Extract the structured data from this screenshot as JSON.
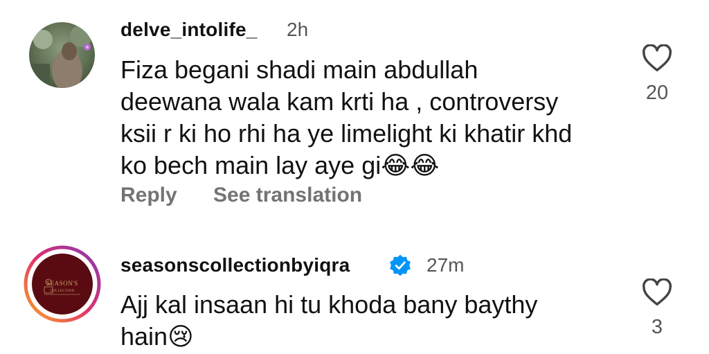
{
  "comments": [
    {
      "username": "delve_intolife_",
      "time": "2h",
      "lines": [
        "Fiza begani shadi main abdullah",
        "deewana wala kam krti ha , controversy",
        "ksii r ki ho rhi ha ye limelight ki khatir khd",
        "ko bech main lay aye gi"
      ],
      "emoji": [
        "😂",
        "😂"
      ],
      "emoji_icon": "face-with-tears-of-joy-icon",
      "like_count": "20",
      "reply_label": "Reply",
      "translate_label": "See translation"
    },
    {
      "username": "seasonscollectionbyiqra",
      "verified": true,
      "time": "27m",
      "lines": [
        "Ajj kal insaan hi tu khoda bany baythy",
        "hain"
      ],
      "emoji": [
        "😢"
      ],
      "emoji_icon": "crying-face-icon",
      "like_count": "3",
      "avatar_logo_text": "SEASON'S COLLECTION"
    }
  ],
  "colors": {
    "verified": "#0095f6",
    "story_ring_start": "#f9a825",
    "story_ring_mid": "#e1306c",
    "story_ring_end": "#833ab4",
    "logo_bg": "#5a0b12",
    "logo_gold": "#c9a86a"
  }
}
